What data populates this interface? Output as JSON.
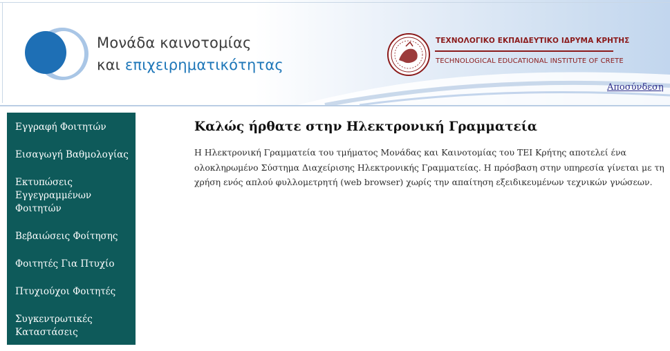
{
  "header": {
    "unit_title_line1": "Μονάδα καινοτομίας",
    "unit_title_line2_a": "και",
    "unit_title_line2_b": "επιχειρηματικότητας",
    "institute_greek": "ΤΕΧΝΟΛΟΓΙΚΟ ΕΚΠΑΙΔΕΥΤΙΚΟ ΙΔΡΥΜΑ ΚΡΗΤΗΣ",
    "institute_english": "TECHNOLOGICAL EDUCATIONAL INSTITUTE OF CRETE",
    "logout_label": "Αποσύνδεση",
    "brand_color": "#1d76b8",
    "institute_color": "#8b1a1a"
  },
  "sidebar": {
    "background_color": "#0e5a5a",
    "items": [
      {
        "label": "Εγγραφή Φοιτητών"
      },
      {
        "label": "Εισαγωγή Βαθμολογίας"
      },
      {
        "label": "Εκτυπώσεις Εγγεγραμμένων Φοιτητών"
      },
      {
        "label": "Βεβαιώσεις Φοίτησης"
      },
      {
        "label": "Φοιτητές Για Πτυχίο"
      },
      {
        "label": "Πτυχιούχοι Φοιτητές"
      },
      {
        "label": "Συγκεντρωτικές Καταστάσεις"
      }
    ]
  },
  "main": {
    "title": "Καλώς ήρθατε στην Ηλεκτρονική Γραμματεία",
    "intro": "Η Ηλεκτρονική Γραμματεία του τμήματος Μονάδας και Καινοτομίας του ΤΕΙ Κρήτης αποτελεί ένα ολοκληρωμένο Σύστημα Διαχείρισης Ηλεκτρονικής Γραμματείας. Η πρόσβαση στην υπηρεσία γίνεται με τη χρήση ενός απλού φυλλομετρητή (web browser) χωρίς την απαίτηση εξειδικευμένων τεχνικών γνώσεων."
  }
}
